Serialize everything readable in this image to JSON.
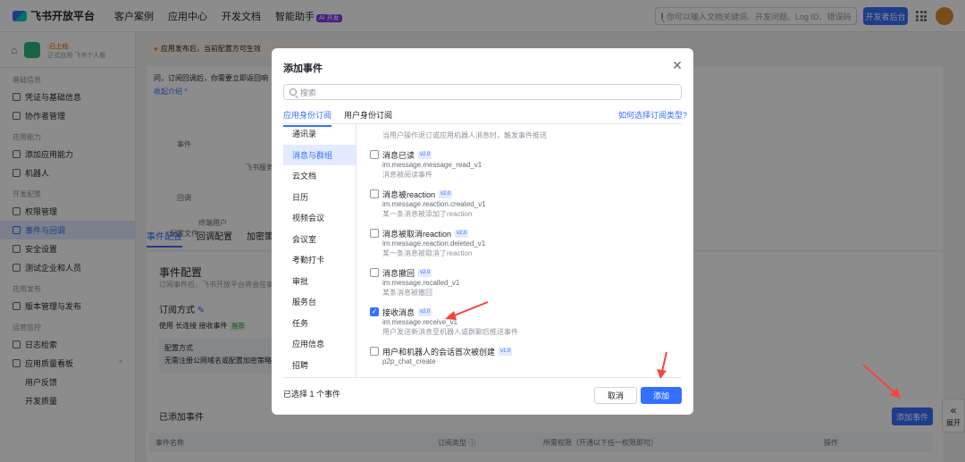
{
  "nav": {
    "logo": "飞书开放平台",
    "links": [
      "客户案例",
      "应用中心",
      "开发文档",
      "智能助手"
    ],
    "ai_badge": "AI 开发",
    "search_placeholder": "你可以输入文档关键词、开发问题、Log ID、错误码",
    "dev_button": "开发者后台"
  },
  "sidebar": {
    "app_sub": "正式应用 飞书个人版",
    "app_badge": "已上线",
    "sections": [
      {
        "title": "基础信息",
        "items": [
          "凭证与基础信息",
          "协作者管理"
        ]
      },
      {
        "title": "应用能力",
        "items": [
          "添加应用能力",
          "机器人"
        ]
      },
      {
        "title": "开发配置",
        "items": [
          "权限管理",
          "事件与回调",
          "安全设置",
          "测试企业和人员"
        ]
      },
      {
        "title": "应用发布",
        "items": [
          "版本管理与发布"
        ]
      },
      {
        "title": "运营监控",
        "items": [
          "日志检索",
          "应用质量看板"
        ]
      }
    ],
    "children": [
      "用户反馈",
      "开发质量"
    ]
  },
  "main": {
    "notice": "应用发布后，当前配置方可生效",
    "intro_text": "问，订阅回调后，你需要立即返回响",
    "collapse_link": "收起介绍",
    "diagram_labels": [
      "事件",
      "飞书服务器",
      "回调",
      "终端用户",
      "配置文件"
    ],
    "tabs": [
      "事件配置",
      "回调配置",
      "加密策略"
    ],
    "section_title": "事件配置",
    "section_desc": "订阅事件后，飞书开放平台将会在事",
    "sub_mode_label": "订阅方式",
    "sub_mode_value": "使用 长连接 接收事件",
    "sub_mode_tag": "推荐",
    "config_label": "配置方式",
    "config_desc": "无需注册公网域名或配置加密策略",
    "added_title": "已添加事件",
    "add_event_button": "添加事件",
    "table_headers": [
      "事件名称",
      "订阅类型 ⓘ",
      "所需权限（开通以下任一权限即可）",
      "操作"
    ],
    "expand_label": "展开"
  },
  "modal": {
    "title": "添加事件",
    "search_placeholder": "搜索",
    "tabs": [
      "应用身份订阅",
      "用户身份订阅"
    ],
    "how_link": "如何选择订阅类型?",
    "categories": [
      "通讯录",
      "消息与群组",
      "云文档",
      "日历",
      "视频会议",
      "会议室",
      "考勤打卡",
      "审批",
      "服务台",
      "任务",
      "应用信息",
      "招聘"
    ],
    "active_category": "消息与群组",
    "top_desc": "当用户操作退订或应用机器人消息时，触发事件推送",
    "events": [
      {
        "name": "消息已读",
        "version": "v2.0",
        "code": "im.message.message_read_v1",
        "desc": "消息被阅读事件",
        "checked": false
      },
      {
        "name": "消息被reaction",
        "version": "v2.0",
        "code": "im.message.reaction.created_v1",
        "desc": "某一条消息被添加了reaction",
        "checked": false
      },
      {
        "name": "消息被取消reaction",
        "version": "v2.0",
        "code": "im.message.reaction.deleted_v1",
        "desc": "某一条消息被取消了reaction",
        "checked": false
      },
      {
        "name": "消息撤回",
        "version": "v2.0",
        "code": "im.message.recalled_v1",
        "desc": "某条消息被撤回",
        "checked": false
      },
      {
        "name": "接收消息",
        "version": "v2.0",
        "code": "im.message.receive_v1",
        "desc": "用户发送新消息至机器人或群聊后推送事件",
        "checked": true
      },
      {
        "name": "用户和机器人的会话首次被创建",
        "version": "v1.0",
        "code": "p2p_chat_create",
        "desc": "",
        "checked": false
      }
    ],
    "selected_count": "已选择 1 个事件",
    "cancel": "取消",
    "add": "添加"
  },
  "colors": {
    "accent": "#3370ff",
    "arrow": "#f5453b"
  }
}
